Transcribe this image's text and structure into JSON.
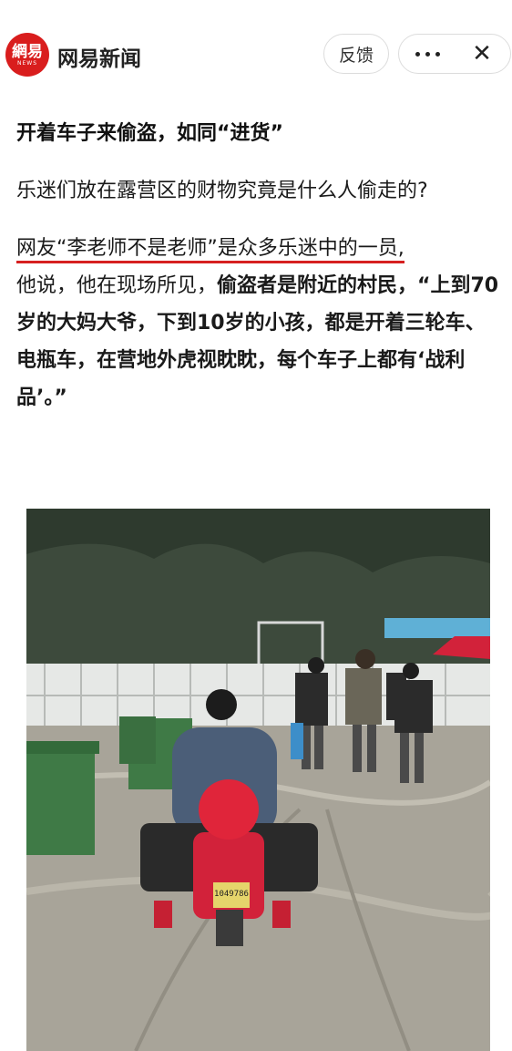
{
  "header": {
    "logo_text": "網易",
    "logo_sub": "NEWS",
    "app_name": "网易新闻",
    "feedback_label": "反馈",
    "close_symbol": "✕",
    "more_icon": "more-dots-icon"
  },
  "article": {
    "heading": "开着车子来偷盗，如同“进货”",
    "para1": "乐迷们放在露营区的财物究竟是什么人偷走的?",
    "para2": {
      "highlight": "网友“李老师不是老师”是众多乐迷中的一员,",
      "plain": "他说，他在现场所见，",
      "bold": "偷盗者是附近的村民，“上到70岁的大妈大爷，下到10岁的小孩，都是开着三轮车、电瓶车，在营地外虎视眈眈，每个车子上都有‘战利品’。”"
    }
  },
  "photo": {
    "plate_text": "1049786",
    "colors": {
      "sky": "#c9cdca",
      "trees": "#3d4a3c",
      "mud": "#a8a499",
      "bin": "#3f7a46",
      "helmet": "#e0253a"
    }
  }
}
